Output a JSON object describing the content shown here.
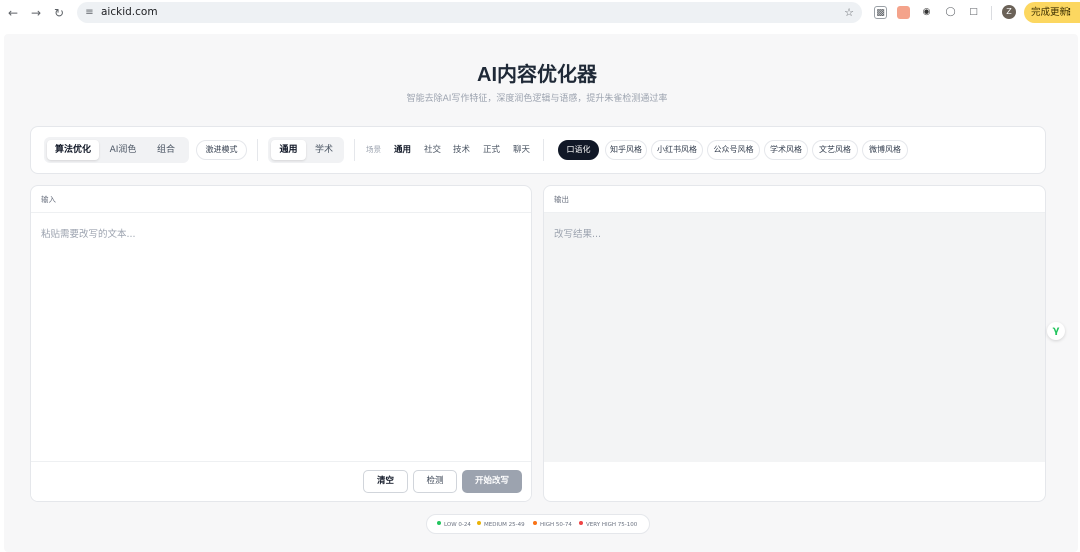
{
  "browser": {
    "url": "aickid.com",
    "update_label": "完成更新",
    "avatar_letter": "Z"
  },
  "page": {
    "title": "AI内容优化器",
    "subtitle": "智能去除AI写作特征，深度润色逻辑与语感，提升朱雀检测通过率"
  },
  "toolbar": {
    "modes": [
      "算法优化",
      "AI润色",
      "组合"
    ],
    "aggressive_label": "激进模式",
    "domains": [
      "通用",
      "学术"
    ],
    "scene_label": "场景",
    "scenes": [
      "通用",
      "社交",
      "技术",
      "正式",
      "聊天"
    ],
    "styles": [
      "口语化",
      "知乎风格",
      "小红书风格",
      "公众号风格",
      "学术风格",
      "文艺风格",
      "微博风格"
    ]
  },
  "input_panel": {
    "label": "输入",
    "placeholder": "粘贴需要改写的文本...",
    "clear_label": "清空",
    "detect_label": "检测",
    "start_label": "开始改写"
  },
  "output_panel": {
    "label": "输出",
    "placeholder": "改写结果..."
  },
  "legend": {
    "items": [
      {
        "label": "LOW 0-24",
        "color": "#22c55e"
      },
      {
        "label": "MEDIUM 25-49",
        "color": "#eab308"
      },
      {
        "label": "HIGH 50-74",
        "color": "#f97316"
      },
      {
        "label": "VERY HIGH 75-100",
        "color": "#ef4444"
      }
    ]
  }
}
